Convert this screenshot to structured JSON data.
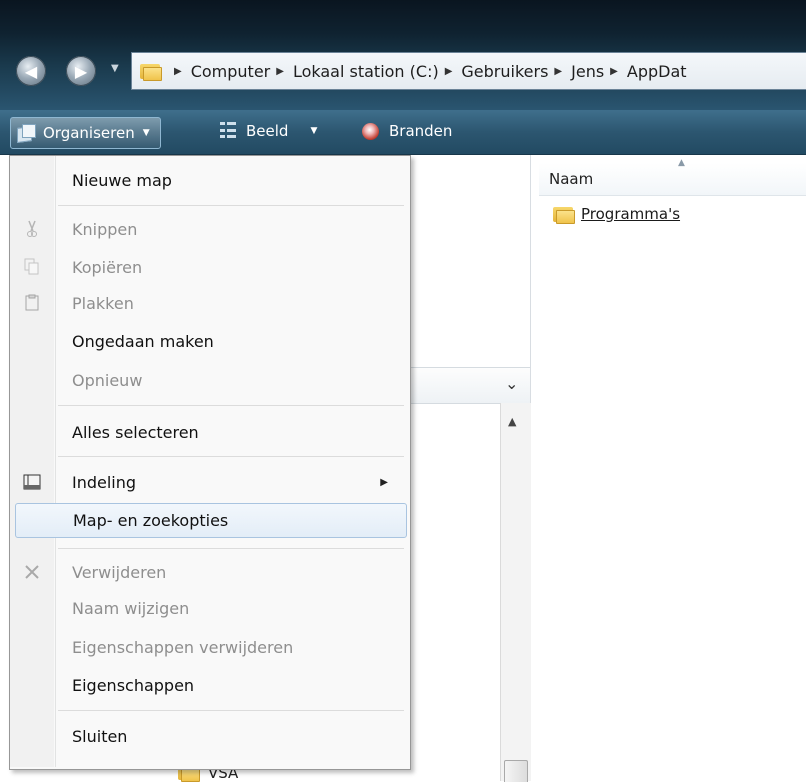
{
  "address": {
    "crumbs": [
      "Computer",
      "Lokaal station (C:)",
      "Gebruikers",
      "Jens",
      "AppDat"
    ]
  },
  "toolbar": {
    "organize_label": "Organiseren",
    "view_label": "Beeld",
    "burn_label": "Branden"
  },
  "file_list": {
    "column_name": "Naam",
    "items": [
      {
        "name": "Programma's",
        "icon": "folder-icon"
      }
    ]
  },
  "tree": {
    "partial_item": "VSA"
  },
  "menu": {
    "items": [
      {
        "label": "Nieuwe map",
        "enabled": true
      },
      {
        "label": "Knippen",
        "enabled": false,
        "icon": "scissors-icon"
      },
      {
        "label": "Kopiëren",
        "enabled": false,
        "icon": "copy-icon"
      },
      {
        "label": "Plakken",
        "enabled": false,
        "icon": "paste-icon"
      },
      {
        "label": "Ongedaan maken",
        "enabled": true
      },
      {
        "label": "Opnieuw",
        "enabled": false
      },
      {
        "label": "Alles selecteren",
        "enabled": true
      },
      {
        "label": "Indeling",
        "enabled": true,
        "icon": "layout-icon",
        "submenu": true
      },
      {
        "label": "Map- en zoekopties",
        "enabled": true,
        "highlighted": true
      },
      {
        "label": "Verwijderen",
        "enabled": false,
        "icon": "delete-icon"
      },
      {
        "label": "Naam wijzigen",
        "enabled": false
      },
      {
        "label": "Eigenschappen verwijderen",
        "enabled": false
      },
      {
        "label": "Eigenschappen",
        "enabled": true
      },
      {
        "label": "Sluiten",
        "enabled": true
      }
    ]
  }
}
